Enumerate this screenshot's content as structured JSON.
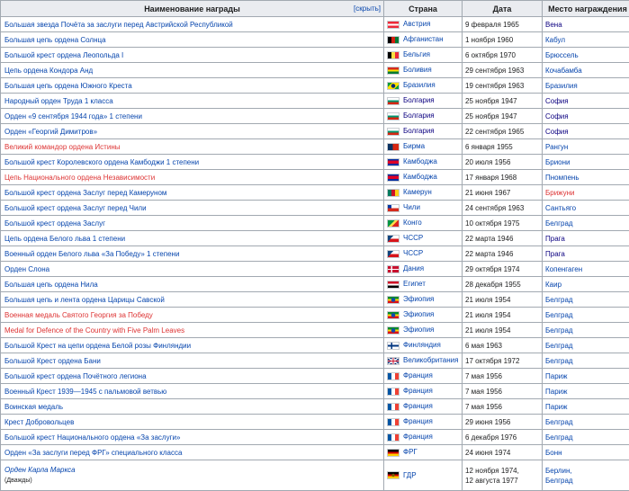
{
  "header": {
    "award": "Наименование награды",
    "hide": "[скрыть]",
    "country": "Страна",
    "date": "Дата",
    "place": "Место награждения"
  },
  "rows": [
    {
      "award": "Большая звезда Почёта за заслуги перед Австрийской Республикой",
      "award_color": "blue",
      "country": "Австрия",
      "flag": "austria",
      "date": "9 февраля 1965",
      "place": "Вена",
      "place_color": "visited"
    },
    {
      "award": "Большая цепь ордена Солнца",
      "award_color": "blue",
      "country": "Афганистан",
      "flag": "afghanistan",
      "date": "1 ноября 1960",
      "place": "Кабул",
      "place_color": "blue"
    },
    {
      "award": "Большой крест ордена Леопольда I",
      "award_color": "blue",
      "country": "Бельгия",
      "flag": "belgium",
      "date": "6 октября 1970",
      "place": "Брюссель",
      "place_color": "blue"
    },
    {
      "award": "Цепь ордена Кондора Анд",
      "award_color": "blue",
      "country": "Боливия",
      "flag": "bolivia",
      "date": "29 сентября 1963",
      "place": "Кочабамба",
      "place_color": "blue"
    },
    {
      "award": "Большая цепь ордена Южного Креста",
      "award_color": "blue",
      "country": "Бразилия",
      "flag": "brazil",
      "date": "19 сентября 1963",
      "place": "Бразилия",
      "place_color": "blue"
    },
    {
      "award": "Народный орден Труда 1 класса",
      "award_color": "blue",
      "country": "Болгария",
      "flag": "bulgaria",
      "date": "25 ноября 1947",
      "place": "София",
      "place_color": "visited",
      "country_color": "visited"
    },
    {
      "award": "Орден «9 сентября 1944 года» 1 степени",
      "award_color": "blue",
      "country": "Болгария",
      "flag": "bulgaria",
      "date": "25 ноября 1947",
      "place": "София",
      "place_color": "visited",
      "country_color": "visited"
    },
    {
      "award": "Орден «Георгий Димитров»",
      "award_color": "blue",
      "country": "Болгария",
      "flag": "bulgaria",
      "date": "22 сентября 1965",
      "place": "София",
      "place_color": "visited",
      "country_color": "visited"
    },
    {
      "award": "Великий командор ордена Истины",
      "award_color": "red",
      "country": "Бирма",
      "flag": "burma",
      "date": "6 января 1955",
      "place": "Рангун",
      "place_color": "blue"
    },
    {
      "award": "Большой крест Королевского ордена Камбоджи 1 степени",
      "award_color": "blue",
      "country": "Камбоджа",
      "flag": "cambodia",
      "date": "20 июля 1956",
      "place": "Бриони",
      "place_color": "blue"
    },
    {
      "award": "Цепь Национального ордена Независимости",
      "award_color": "red",
      "country": "Камбоджа",
      "flag": "cambodia",
      "date": "17 января 1968",
      "place": "Пномпень",
      "place_color": "blue"
    },
    {
      "award": "Большой крест ордена Заслуг перед Камеруном",
      "award_color": "blue",
      "country": "Камерун",
      "flag": "cameroon",
      "date": "21 июня 1967",
      "place": "Брижуни",
      "place_color": "red"
    },
    {
      "award": "Большой крест ордена Заслуг перед Чили",
      "award_color": "blue",
      "country": "Чили",
      "flag": "chile",
      "date": "24 сентября 1963",
      "place": "Сантьяго",
      "place_color": "blue"
    },
    {
      "award": "Большой крест ордена Заслуг",
      "award_color": "blue",
      "country": "Конго",
      "flag": "congo",
      "date": "10 октября 1975",
      "place": "Белград",
      "place_color": "blue"
    },
    {
      "award": "Цепь ордена Белого льва 1 степени",
      "award_color": "blue",
      "country": "ЧССР",
      "flag": "czech",
      "date": "22 марта 1946",
      "place": "Прага",
      "place_color": "visited"
    },
    {
      "award": "Военный орден Белого льва «За Победу» 1 степени",
      "award_color": "blue",
      "country": "ЧССР",
      "flag": "czech",
      "date": "22 марта 1946",
      "place": "Прага",
      "place_color": "visited"
    },
    {
      "award": "Орден Слона",
      "award_color": "blue",
      "country": "Дания",
      "flag": "denmark",
      "date": "29 октября 1974",
      "place": "Копенгаген",
      "place_color": "blue"
    },
    {
      "award": "Большая цепь ордена Нила",
      "award_color": "blue",
      "country": "Египет",
      "flag": "egypt",
      "date": "28 декабря 1955",
      "place": "Каир",
      "place_color": "blue"
    },
    {
      "award": "Большая цепь и лента ордена Царицы Савской",
      "award_color": "blue",
      "country": "Эфиопия",
      "flag": "ethiopia",
      "date": "21 июля 1954",
      "place": "Белград",
      "place_color": "blue"
    },
    {
      "award": "Военная медаль Святого Георгия за Победу",
      "award_color": "red",
      "country": "Эфиопия",
      "flag": "ethiopia",
      "date": "21 июля 1954",
      "place": "Белград",
      "place_color": "blue"
    },
    {
      "award": "Medal for Defence of the Country with Five Palm Leaves",
      "award_color": "red",
      "country": "Эфиопия",
      "flag": "ethiopia",
      "date": "21 июля 1954",
      "place": "Белград",
      "place_color": "blue"
    },
    {
      "award": "Большой Крест на цепи ордена Белой розы Финляндии",
      "award_color": "blue",
      "country": "Финляндия",
      "flag": "finland",
      "date": "6 мая 1963",
      "place": "Белград",
      "place_color": "blue"
    },
    {
      "award": "Большой Крест ордена Бани",
      "award_color": "blue",
      "country": "Великобритания",
      "flag": "uk",
      "date": "17 октября 1972",
      "place": "Белград",
      "place_color": "blue"
    },
    {
      "award": "Большой крест ордена Почётного легиона",
      "award_color": "blue",
      "country": "Франция",
      "flag": "france",
      "date": "7 мая 1956",
      "place": "Париж",
      "place_color": "blue"
    },
    {
      "award": "Военный Крест 1939—1945 с пальмовой ветвью",
      "award_color": "blue",
      "country": "Франция",
      "flag": "france",
      "date": "7 мая 1956",
      "place": "Париж",
      "place_color": "blue"
    },
    {
      "award": "Воинская медаль",
      "award_color": "blue",
      "country": "Франция",
      "flag": "france",
      "date": "7 мая 1956",
      "place": "Париж",
      "place_color": "blue"
    },
    {
      "award": "Крест Добровольцев",
      "award_color": "blue",
      "country": "Франция",
      "flag": "france",
      "date": "29 июня 1956",
      "place": "Белград",
      "place_color": "blue"
    },
    {
      "award": "Большой крест Национального ордена «За заслуги»",
      "award_color": "blue",
      "country": "Франция",
      "flag": "france",
      "date": "6 декабря 1976",
      "place": "Белград",
      "place_color": "blue"
    },
    {
      "award": "Орден «За заслуги перед ФРГ» специального класса",
      "award_color": "blue",
      "country": "ФРГ",
      "flag": "germany",
      "date": "24 июня 1974",
      "place": "Бонн",
      "place_color": "blue"
    }
  ],
  "last_row": {
    "award": "Орден Карла Маркса",
    "note": "(Дважды)",
    "country": "ГДР",
    "date1": "12 ноября 1974,",
    "date2": "12 августа 1977",
    "place1": "Берлин,",
    "place2": "Белград"
  }
}
